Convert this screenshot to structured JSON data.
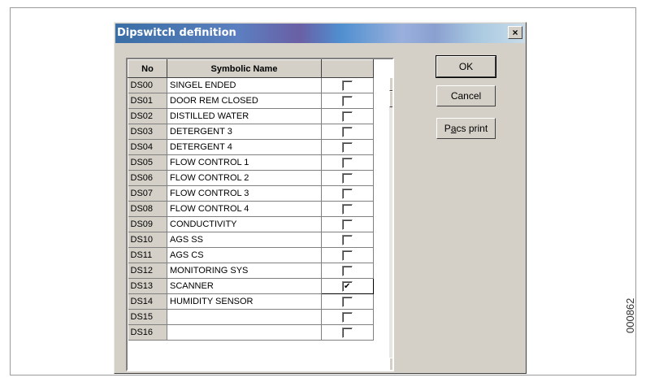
{
  "dialog": {
    "title": "Dipswitch definition",
    "close_label": "×"
  },
  "grid": {
    "headers": {
      "no": "No",
      "name": "Symbolic Name",
      "check": ""
    },
    "rows": [
      {
        "no": "DS00",
        "name": "SINGEL ENDED",
        "checked": false
      },
      {
        "no": "DS01",
        "name": "DOOR REM CLOSED",
        "checked": false
      },
      {
        "no": "DS02",
        "name": "DISTILLED WATER",
        "checked": false
      },
      {
        "no": "DS03",
        "name": "DETERGENT 3",
        "checked": false
      },
      {
        "no": "DS04",
        "name": "DETERGENT 4",
        "checked": false
      },
      {
        "no": "DS05",
        "name": "FLOW CONTROL 1",
        "checked": false
      },
      {
        "no": "DS06",
        "name": "FLOW CONTROL 2",
        "checked": false
      },
      {
        "no": "DS07",
        "name": "FLOW CONTROL 3",
        "checked": false
      },
      {
        "no": "DS08",
        "name": "FLOW CONTROL 4",
        "checked": false
      },
      {
        "no": "DS09",
        "name": "CONDUCTIVITY",
        "checked": false
      },
      {
        "no": "DS10",
        "name": "AGS SS",
        "checked": false
      },
      {
        "no": "DS11",
        "name": "AGS CS",
        "checked": false
      },
      {
        "no": "DS12",
        "name": "MONITORING SYS",
        "checked": false
      },
      {
        "no": "DS13",
        "name": "SCANNER",
        "checked": true
      },
      {
        "no": "DS14",
        "name": "HUMIDITY SENSOR",
        "checked": false
      },
      {
        "no": "DS15",
        "name": "",
        "checked": false
      },
      {
        "no": "DS16",
        "name": "",
        "checked": false
      }
    ],
    "scroll_up_icon": "arrow-up-icon",
    "scroll_down_icon": "arrow-down-icon"
  },
  "buttons": {
    "ok": "OK",
    "cancel": "Cancel",
    "pacs_print_prefix": "P",
    "pacs_print_underlined": "a",
    "pacs_print_suffix": "cs print"
  },
  "side_label": "000862"
}
